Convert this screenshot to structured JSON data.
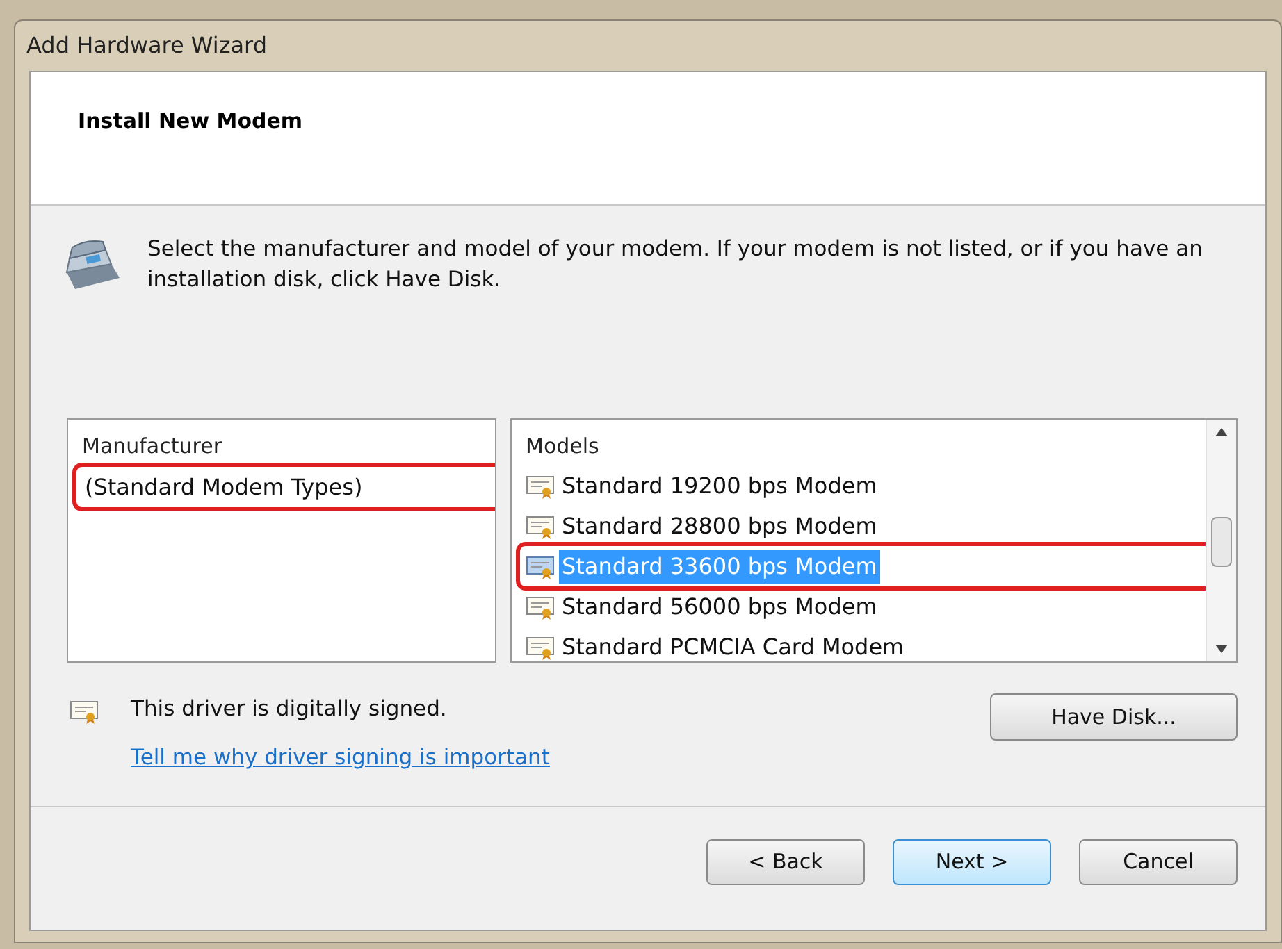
{
  "window": {
    "title": "Add Hardware Wizard"
  },
  "header": {
    "title": "Install New Modem"
  },
  "instruction": "Select the manufacturer and model of your modem. If your modem is not listed, or if you have an installation disk, click Have Disk.",
  "manufacturer_list": {
    "heading": "Manufacturer",
    "items": [
      {
        "label": "(Standard Modem Types)",
        "selected": false,
        "annotated": true
      }
    ]
  },
  "models_list": {
    "heading": "Models",
    "items": [
      {
        "label": "Standard 19200 bps Modem",
        "selected": false,
        "annotated": false
      },
      {
        "label": "Standard 28800 bps Modem",
        "selected": false,
        "annotated": false
      },
      {
        "label": "Standard 33600 bps Modem",
        "selected": true,
        "annotated": true
      },
      {
        "label": "Standard 56000 bps Modem",
        "selected": false,
        "annotated": false
      },
      {
        "label": "Standard PCMCIA Card Modem",
        "selected": false,
        "annotated": false
      }
    ]
  },
  "signing": {
    "text": "This driver is digitally signed.",
    "link": "Tell me why driver signing is important"
  },
  "have_disk_button": "Have Disk...",
  "buttons": [
    {
      "label": "< Back",
      "selected": false
    },
    {
      "label": "Next >",
      "selected": true
    },
    {
      "label": "Cancel",
      "selected": false
    }
  ]
}
